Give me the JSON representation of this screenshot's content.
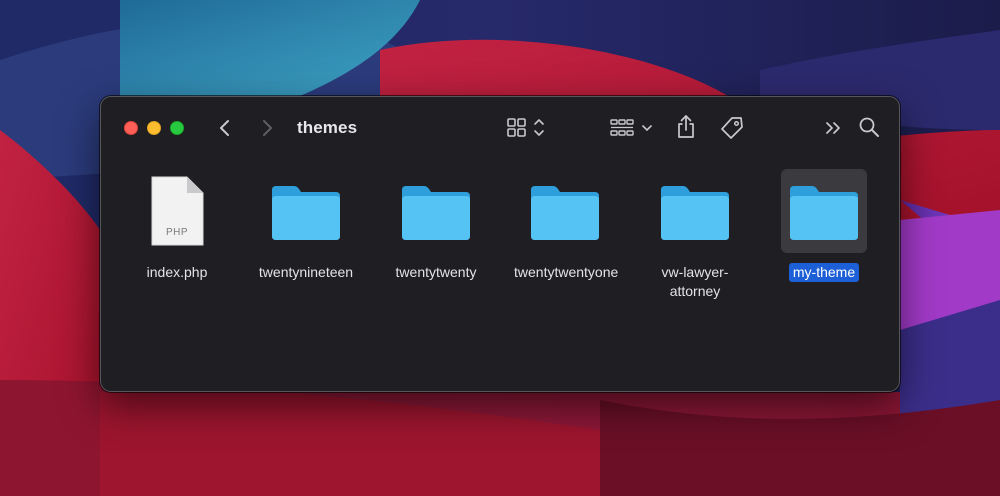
{
  "window": {
    "title": "themes"
  },
  "toolbar": {
    "back_icon": "chevron-left-icon",
    "forward_icon": "chevron-right-icon",
    "view_mode_icon": "icon-grid-view-icon",
    "group_icon": "group-by-icon",
    "share_icon": "share-icon",
    "tag_icon": "tag-icon",
    "more_icon": "chevron-double-right-icon",
    "search_icon": "search-icon"
  },
  "files": [
    {
      "name": "index.php",
      "kind": "php-file",
      "ext_label": "PHP",
      "selected": false
    },
    {
      "name": "twentynineteen",
      "kind": "folder",
      "selected": false
    },
    {
      "name": "twentytwenty",
      "kind": "folder",
      "selected": false
    },
    {
      "name": "twentytwentyone",
      "kind": "folder",
      "selected": false
    },
    {
      "name": "vw-lawyer-attorney",
      "kind": "folder",
      "selected": false
    },
    {
      "name": "my-theme",
      "kind": "folder",
      "selected": true
    }
  ],
  "colors": {
    "folder": "#4fbdf0",
    "selection": "#1d5fd6",
    "window_bg": "#1f1e23"
  }
}
